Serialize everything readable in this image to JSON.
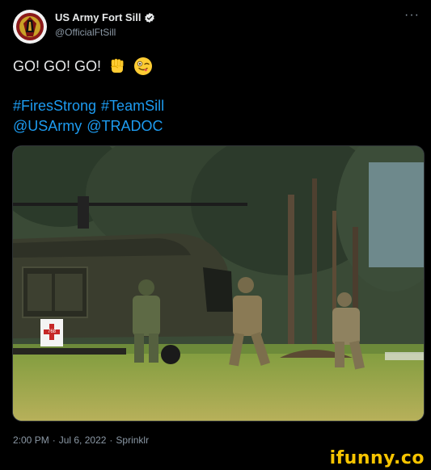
{
  "author": {
    "display_name": "US Army Fort Sill",
    "handle": "@OfficialFtSill"
  },
  "more_label": "···",
  "tweet": {
    "line1": "GO! GO! GO!",
    "hashtags": [
      "#FiresStrong",
      "#TeamSill"
    ],
    "mentions": [
      "@USArmy",
      "@TRADOC"
    ]
  },
  "media": {
    "tail_number": "768"
  },
  "meta": {
    "time": "2:00 PM",
    "date": "Jul 6, 2022",
    "source": "Sprinklr",
    "sep": "·"
  },
  "watermark": "ifunny.co",
  "colors": {
    "background": "#000000",
    "link": "#1d9bf0",
    "muted": "#8b98a5",
    "watermark": "#f6c400"
  },
  "icons": [
    "verified-badge-icon",
    "raised-fist-emoji",
    "winking-tongue-emoji",
    "more-icon"
  ]
}
